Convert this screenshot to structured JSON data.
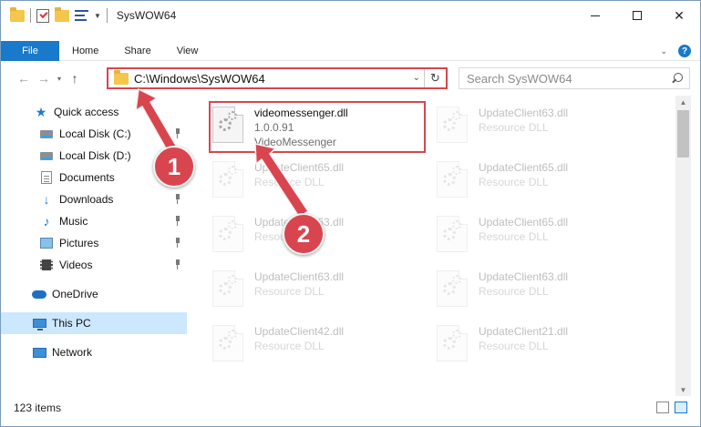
{
  "window": {
    "title": "SysWOW64"
  },
  "ribbon": {
    "tabs": [
      "File",
      "Home",
      "Share",
      "View"
    ],
    "help_label": "?"
  },
  "nav": {
    "address": "C:\\Windows\\SysWOW64",
    "search_placeholder": "Search SysWOW64"
  },
  "sidebar": {
    "items": [
      {
        "label": "Quick access",
        "icon": "star-icon"
      },
      {
        "label": "Local Disk (C:)",
        "icon": "drive-icon"
      },
      {
        "label": "Local Disk (D:)",
        "icon": "drive-icon"
      },
      {
        "label": "Documents",
        "icon": "documents-icon"
      },
      {
        "label": "Downloads",
        "icon": "download-icon"
      },
      {
        "label": "Music",
        "icon": "music-icon"
      },
      {
        "label": "Pictures",
        "icon": "pictures-icon"
      },
      {
        "label": "Videos",
        "icon": "videos-icon"
      },
      {
        "label": "OneDrive",
        "icon": "cloud-icon"
      },
      {
        "label": "This PC",
        "icon": "computer-icon"
      },
      {
        "label": "Network",
        "icon": "network-icon"
      }
    ]
  },
  "files": [
    {
      "name": "videomessenger.dll",
      "version": "1.0.0.91",
      "desc": "VideoMessenger"
    },
    {
      "name": "UpdateClient63.dll",
      "desc": "Resource DLL"
    },
    {
      "name": "UpdateClient65.dll",
      "desc": "Resource DLL"
    },
    {
      "name": "UpdateClient65.dll",
      "desc": "Resource DLL"
    },
    {
      "name": "UpdateClient63.dll",
      "desc": "Resource DLL"
    },
    {
      "name": "UpdateClient65.dll",
      "desc": "Resource DLL"
    },
    {
      "name": "UpdateClient63.dll",
      "desc": "Resource DLL"
    },
    {
      "name": "UpdateClient63.dll",
      "desc": "Resource DLL"
    },
    {
      "name": "UpdateClient42.dll",
      "desc": "Resource DLL"
    },
    {
      "name": "UpdateClient21.dll",
      "desc": "Resource DLL"
    }
  ],
  "status": {
    "item_count": "123 items"
  },
  "annotations": {
    "step1": "1",
    "step2": "2"
  },
  "colors": {
    "accent": "#1979ca",
    "highlight": "#d9454f",
    "selected": "#cce8ff"
  }
}
